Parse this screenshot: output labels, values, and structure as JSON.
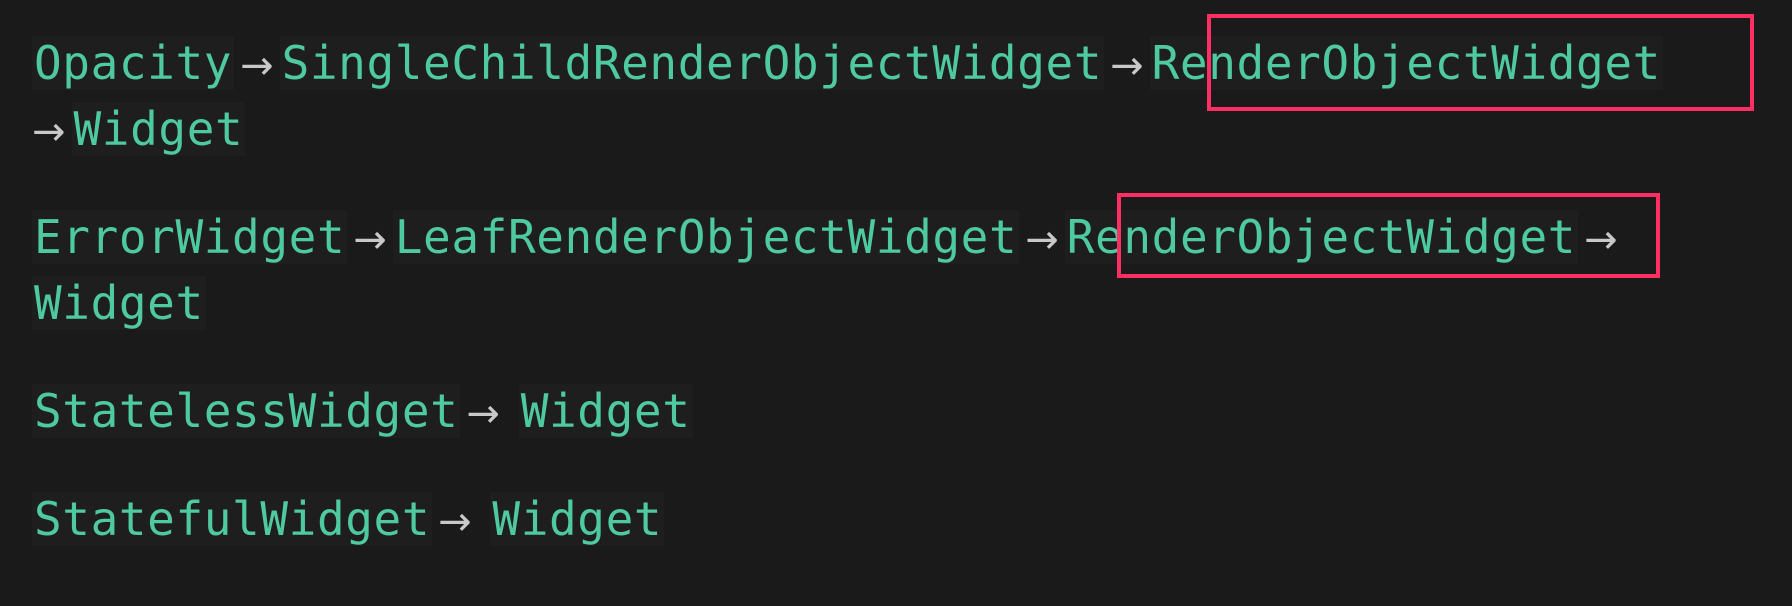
{
  "arrow": "→",
  "chains": [
    {
      "items": [
        "Opacity",
        "SingleChildRenderObjectWidget",
        "RenderObjectWidget",
        "Widget"
      ],
      "highlighted": "RenderObjectWidget"
    },
    {
      "items": [
        "ErrorWidget",
        "LeafRenderObjectWidget",
        "RenderObjectWidget",
        "Widget"
      ],
      "highlighted": "RenderObjectWidget"
    },
    {
      "items": [
        "StatelessWidget",
        "Widget"
      ]
    },
    {
      "items": [
        "StatefulWidget",
        "Widget"
      ]
    }
  ],
  "colors": {
    "background": "#1a1a1a",
    "code_text": "#4ec9a0",
    "arrow": "#c8c8c8",
    "highlight_border": "#ff2e63"
  }
}
